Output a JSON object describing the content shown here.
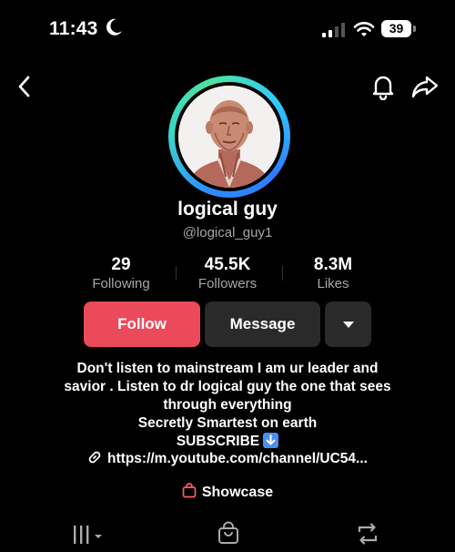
{
  "status_bar": {
    "time": "11:43",
    "battery": "39",
    "icons": [
      "moon-icon",
      "cellular-signal-icon",
      "wifi-icon",
      "battery-icon"
    ]
  },
  "nav": {
    "icons": [
      "back-chevron-icon",
      "bell-icon",
      "share-icon"
    ]
  },
  "profile": {
    "display_name": "logical guy",
    "handle": "@logical_guy1",
    "accent_ring_colors": [
      "#2e8bff",
      "#39d6c8",
      "#4fe3a0"
    ]
  },
  "stats": [
    {
      "value": "29",
      "label": "Following"
    },
    {
      "value": "45.5K",
      "label": "Followers"
    },
    {
      "value": "8.3M",
      "label": "Likes"
    }
  ],
  "actions": {
    "follow": "Follow",
    "message": "Message",
    "follow_color": "#ea4a5a"
  },
  "bio": {
    "lines": [
      "Don't listen to mainstream I am ur leader and",
      "savior . Listen to dr logical  guy  the one that sees",
      "through everything",
      "Secretly Smartest on earth",
      "SUBSCRIBE"
    ]
  },
  "link": "https://m.youtube.com/channel/UC54...",
  "showcase": "Showcase",
  "tabs": [
    "videos-grid-tab",
    "shop-tab",
    "reposts-tab"
  ]
}
